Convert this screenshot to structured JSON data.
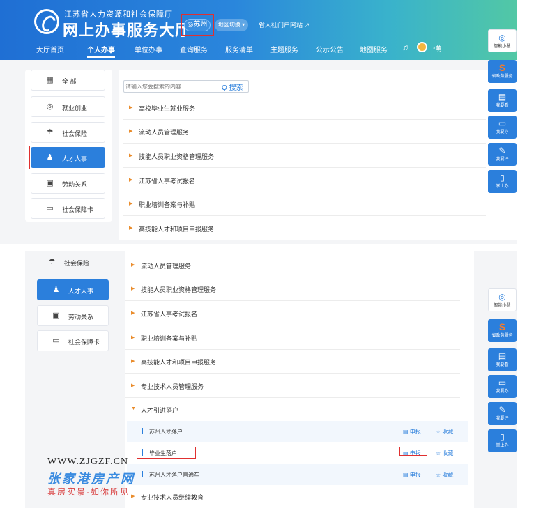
{
  "header": {
    "org_name": "江苏省人力资源和社会保障厅",
    "site_title": "网上办事服务大厅",
    "city": "◎苏州",
    "region_switch": "地区切换 ▾",
    "gate_link": "省人社门户网站 ↗",
    "username": "*萌"
  },
  "nav": [
    "大厅首页",
    "个人办事",
    "单位办事",
    "查询服务",
    "服务清单",
    "主题服务",
    "公示公告",
    "地图服务"
  ],
  "sidebar": [
    {
      "icon": "grid-icon",
      "label": "全 部"
    },
    {
      "icon": "employment-icon",
      "label": "就业创业"
    },
    {
      "icon": "umbrella-icon",
      "label": "社会保险"
    },
    {
      "icon": "people-icon",
      "label": "人才人事"
    },
    {
      "icon": "labor-icon",
      "label": "劳动关系"
    },
    {
      "icon": "card-icon",
      "label": "社会保障卡"
    }
  ],
  "search": {
    "placeholder": "请输入您要搜索的内容",
    "button": "搜索"
  },
  "services_top": [
    "高校毕业生就业服务",
    "流动人员管理服务",
    "技能人员职业资格管理服务",
    "江苏省人事考试报名",
    "职业培训备案与补贴",
    "高技能人才和项目申报服务"
  ],
  "floating": [
    "智能小慧",
    "省政务服务",
    "我要看",
    "我要办",
    "我要评",
    "掌上办"
  ],
  "services_bottom": [
    "流动人员管理服务",
    "技能人员职业资格管理服务",
    "江苏省人事考试报名",
    "职业培训备案与补贴",
    "高技能人才和项目申报服务",
    "专业技术人员管理服务",
    "人才引进落户"
  ],
  "sub_items": [
    "苏州人才落户",
    "毕业生落户",
    "苏州人才落户直通车"
  ],
  "sub_actions": {
    "apply": "▤ 申报",
    "favorite": "☆ 收藏"
  },
  "last_item": "专业技术人员继续教育",
  "watermark": {
    "url": "WWW.ZJGZF.CN",
    "name": "张家港房产网",
    "slogan": "真房实景·如你所见"
  }
}
